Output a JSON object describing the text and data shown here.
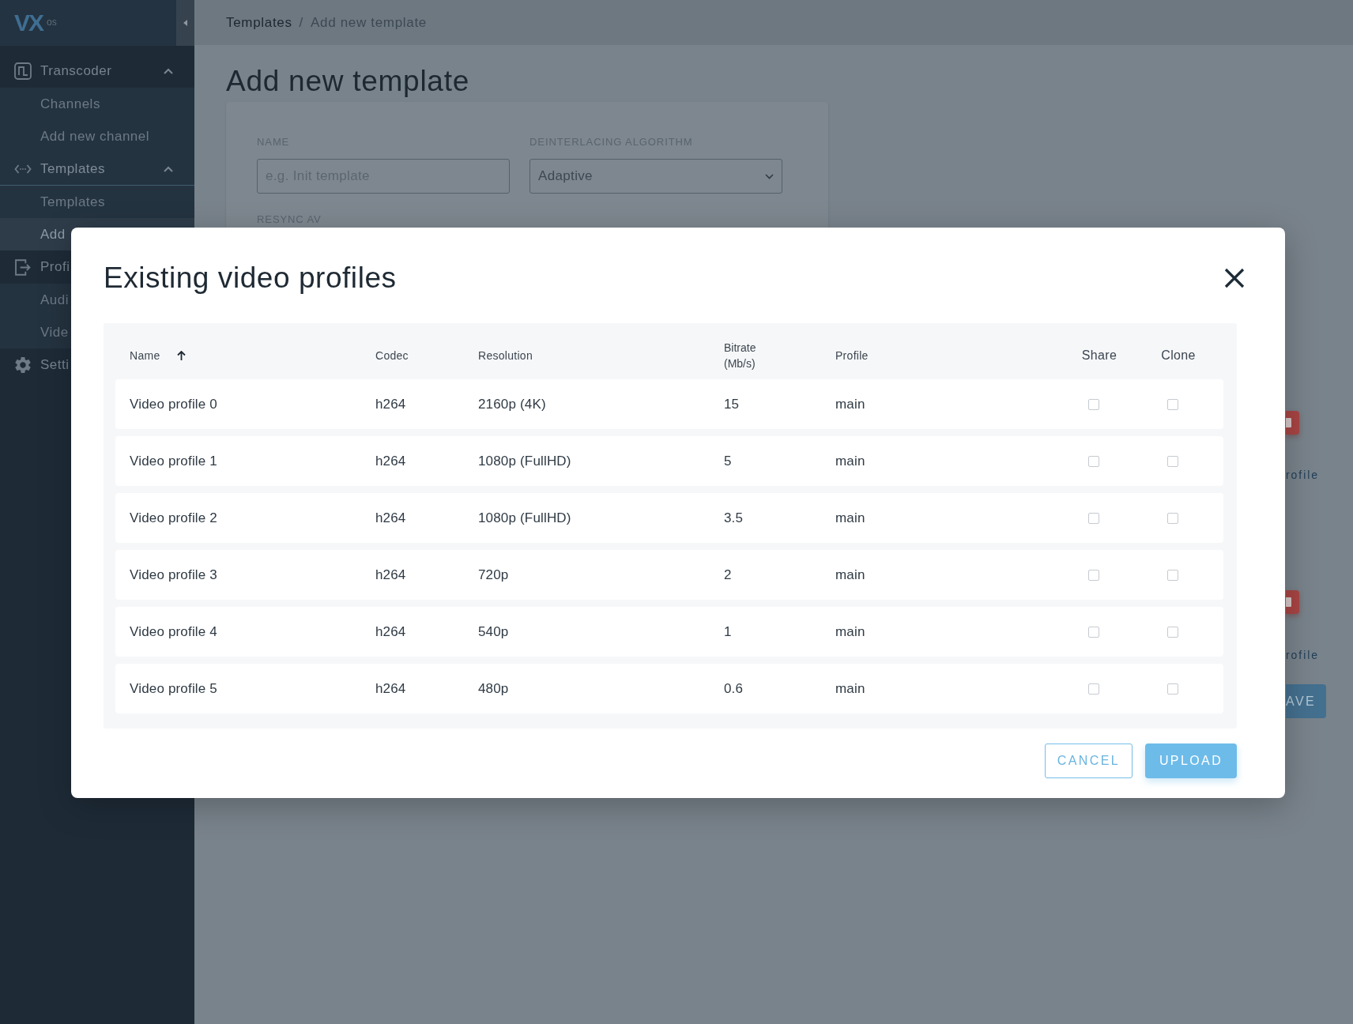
{
  "sidebar": {
    "logo": {
      "mark": "VX",
      "suffix": "os"
    },
    "groups": [
      {
        "label": "Transcoder",
        "selected": false,
        "expanded": true,
        "children": [
          {
            "label": "Channels",
            "selected": false
          },
          {
            "label": "Add new channel",
            "selected": false
          }
        ]
      },
      {
        "label": "Templates",
        "selected": true,
        "expanded": true,
        "children": [
          {
            "label": "Templates",
            "selected": false
          },
          {
            "label": "Add",
            "selected": true
          }
        ]
      },
      {
        "label": "Profi",
        "selected": false,
        "children": [
          {
            "label": "Audi",
            "selected": false
          },
          {
            "label": "Vide",
            "selected": false
          }
        ]
      },
      {
        "label": "Setti",
        "selected": false
      }
    ]
  },
  "breadcrumb": {
    "separator": "/",
    "items": [
      {
        "label": "Templates",
        "current": false
      },
      {
        "label": "Add new template",
        "current": true
      }
    ]
  },
  "page": {
    "title": "Add new template",
    "fields": [
      {
        "kind": "input",
        "label": "NAME",
        "placeholder": "e.g. Init template"
      },
      {
        "kind": "select",
        "label": "DEINTERLACING ALGORITHM",
        "value": "Adaptive"
      }
    ],
    "next_label": "RESYNC AV",
    "side_items": [
      {
        "kind": "icon_button"
      },
      {
        "kind": "link",
        "text": "rofile"
      },
      {
        "kind": "icon_button"
      },
      {
        "kind": "link",
        "text": "rofile"
      },
      {
        "kind": "button",
        "text": "AVE"
      }
    ]
  },
  "modal": {
    "title": "Existing video profiles",
    "table": {
      "columns": [
        {
          "label": "Name",
          "kind": "text",
          "sorted": true,
          "ascending": true
        },
        {
          "label": "Codec",
          "kind": "text",
          "sorted": false
        },
        {
          "label": "Resolution",
          "kind": "text",
          "sorted": false
        },
        {
          "label": "Bitrate (Mb/s)",
          "kind": "text",
          "sorted": false
        },
        {
          "label": "Profile",
          "kind": "text",
          "sorted": false
        },
        {
          "label": "Share",
          "kind": "checkbox",
          "sorted": false
        },
        {
          "label": "Clone",
          "kind": "checkbox",
          "sorted": false
        }
      ],
      "rows": [
        {
          "name": "Video profile 0",
          "codec": "h264",
          "resolution": "2160p (4K)",
          "bitrate": "15",
          "profile": "main",
          "share": false,
          "clone": false
        },
        {
          "name": "Video profile 1",
          "codec": "h264",
          "resolution": "1080p (FullHD)",
          "bitrate": "5",
          "profile": "main",
          "share": false,
          "clone": false
        },
        {
          "name": "Video profile 2",
          "codec": "h264",
          "resolution": "1080p (FullHD)",
          "bitrate": "3.5",
          "profile": "main",
          "share": false,
          "clone": false
        },
        {
          "name": "Video profile 3",
          "codec": "h264",
          "resolution": "720p",
          "bitrate": "2",
          "profile": "main",
          "share": false,
          "clone": false
        },
        {
          "name": "Video profile 4",
          "codec": "h264",
          "resolution": "540p",
          "bitrate": "1",
          "profile": "main",
          "share": false,
          "clone": false
        },
        {
          "name": "Video profile 5",
          "codec": "h264",
          "resolution": "480p",
          "bitrate": "0.6",
          "profile": "main",
          "share": false,
          "clone": false
        }
      ]
    },
    "buttons": [
      {
        "label": "CANCEL",
        "kind": "outline"
      },
      {
        "label": "UPLOAD",
        "kind": "primary"
      }
    ]
  }
}
